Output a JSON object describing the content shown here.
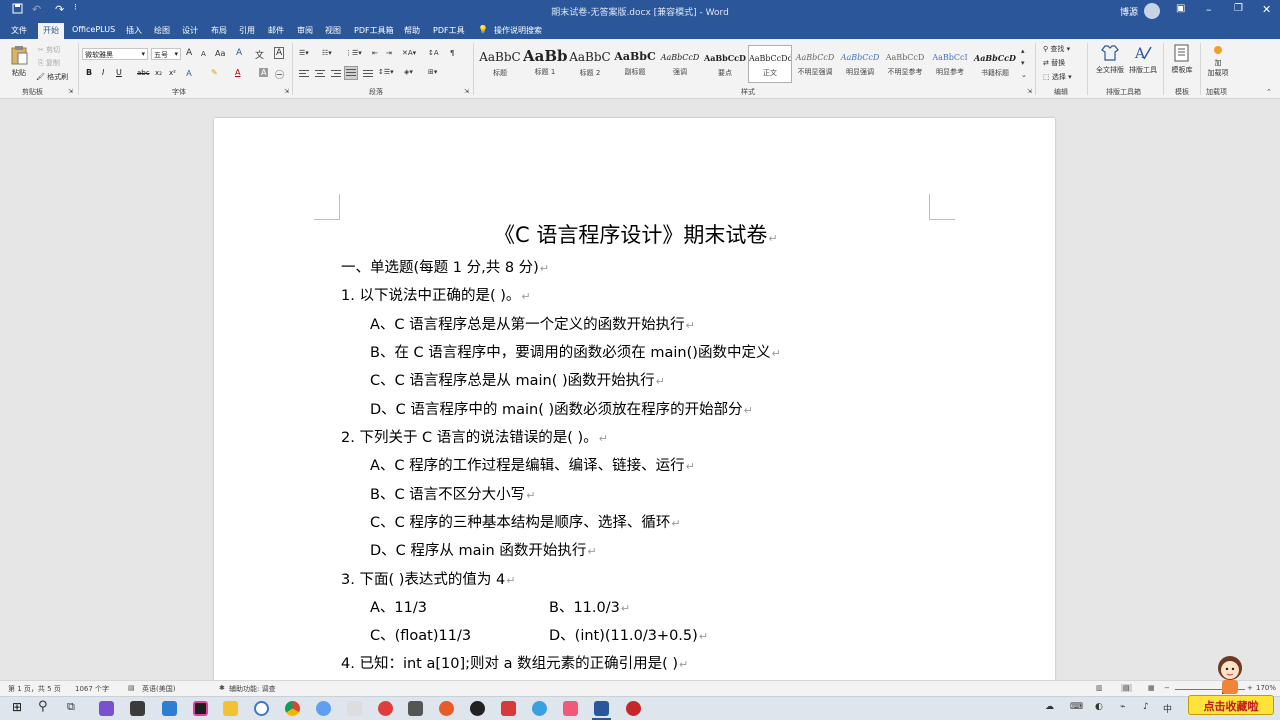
{
  "window": {
    "doc_title": "期末试卷-无答案版.docx [兼容模式] - Word",
    "user_name": "博源"
  },
  "ribbon_tabs": [
    "文件",
    "开始",
    "OfficePLUS",
    "插入",
    "绘图",
    "设计",
    "布局",
    "引用",
    "邮件",
    "审阅",
    "视图",
    "PDF工具箱",
    "帮助",
    "PDF工具"
  ],
  "tell_me": "操作说明搜索",
  "clipboard": {
    "paste": "粘贴",
    "cut": "剪切",
    "copy": "复制",
    "format_painter": "格式刷",
    "group": "剪贴板"
  },
  "font": {
    "name": "微软雅黑",
    "size": "五号",
    "group": "字体",
    "bold": "B",
    "italic": "I",
    "underline": "U",
    "strike": "abc",
    "sub": "x₂",
    "sup": "x²",
    "grow": "A",
    "shrink": "A",
    "aa": "Aa",
    "color_a": "A",
    "wen": "文",
    "clear": "A",
    "char_border": "A"
  },
  "paragraph": {
    "group": "段落"
  },
  "styles": {
    "group": "样式",
    "items": [
      {
        "sample": "AaBbC",
        "label": "标题"
      },
      {
        "sample": "AaBb",
        "label": "标题 1"
      },
      {
        "sample": "AaBbC",
        "label": "标题 2"
      },
      {
        "sample": "AaBbC",
        "label": "副标题"
      },
      {
        "sample": "AaBbCcD",
        "label": "强调"
      },
      {
        "sample": "AaBbCcD",
        "label": "要点"
      },
      {
        "sample": "AaBbCcDd",
        "label": "正文"
      },
      {
        "sample": "AaBbCcD",
        "label": "不明显强调"
      },
      {
        "sample": "AaBbCcD",
        "label": "明显强调"
      },
      {
        "sample": "AaBbCcD",
        "label": "不明显参考"
      },
      {
        "sample": "AaBbCcI",
        "label": "明显参考"
      },
      {
        "sample": "AaBbCcD",
        "label": "书籍标题"
      }
    ]
  },
  "editing": {
    "find": "查找",
    "replace": "替换",
    "select": "选择",
    "group": "编辑"
  },
  "layout_tools": {
    "full_text": "全文排版",
    "layout_tool": "排版工具",
    "group": "排版工具箱"
  },
  "template": {
    "label": "模板库",
    "group": "模板"
  },
  "addins": {
    "label": "加载项",
    "group": "加载项",
    "sublabel": "加"
  },
  "document": {
    "title": "《C 语言程序设计》期末试卷",
    "lines": [
      {
        "text": "一、单选题(每题 1 分,共 8 分)"
      },
      {
        "text": "1.  以下说法中正确的是(        )。"
      },
      {
        "text": "A、C 语言程序总是从第一个定义的函数开始执行"
      },
      {
        "text": "B、在 C 语言程序中，要调用的函数必须在 main()函数中定义"
      },
      {
        "text": "C、C 语言程序总是从 main( )函数开始执行"
      },
      {
        "text": "D、C 语言程序中的 main( )函数必须放在程序的开始部分"
      },
      {
        "text": "2.  下列关于 C 语言的说法错误的是(        )。"
      },
      {
        "text": "A、C 程序的工作过程是编辑、编译、链接、运行"
      },
      {
        "text": "B、C 语言不区分大小写"
      },
      {
        "text": "C、C 程序的三种基本结构是顺序、选择、循环"
      },
      {
        "text": "D、C 程序从 main 函数开始执行"
      },
      {
        "text": "3.  下面(        )表达式的值为 4"
      },
      {
        "text": "A、11/3"
      },
      {
        "text": "B、11.0/3"
      },
      {
        "text": "C、(float)11/3"
      },
      {
        "text": "D、(int)(11.0/3+0.5)"
      },
      {
        "text": "4.  已知：int a[10];则对 a 数组元素的正确引用是(        )"
      }
    ]
  },
  "status": {
    "page": "第 1 页，共 5 页",
    "words": "1067 个字",
    "lang": "英语(美国)",
    "accessibility": "辅助功能: 调查",
    "zoom": "170%"
  },
  "sticker_text": "点击收藏啦",
  "colors": {
    "word_blue": "#2b579a",
    "ribbon_bg": "#f3f3f3",
    "doc_bg": "#e6e6e6"
  }
}
